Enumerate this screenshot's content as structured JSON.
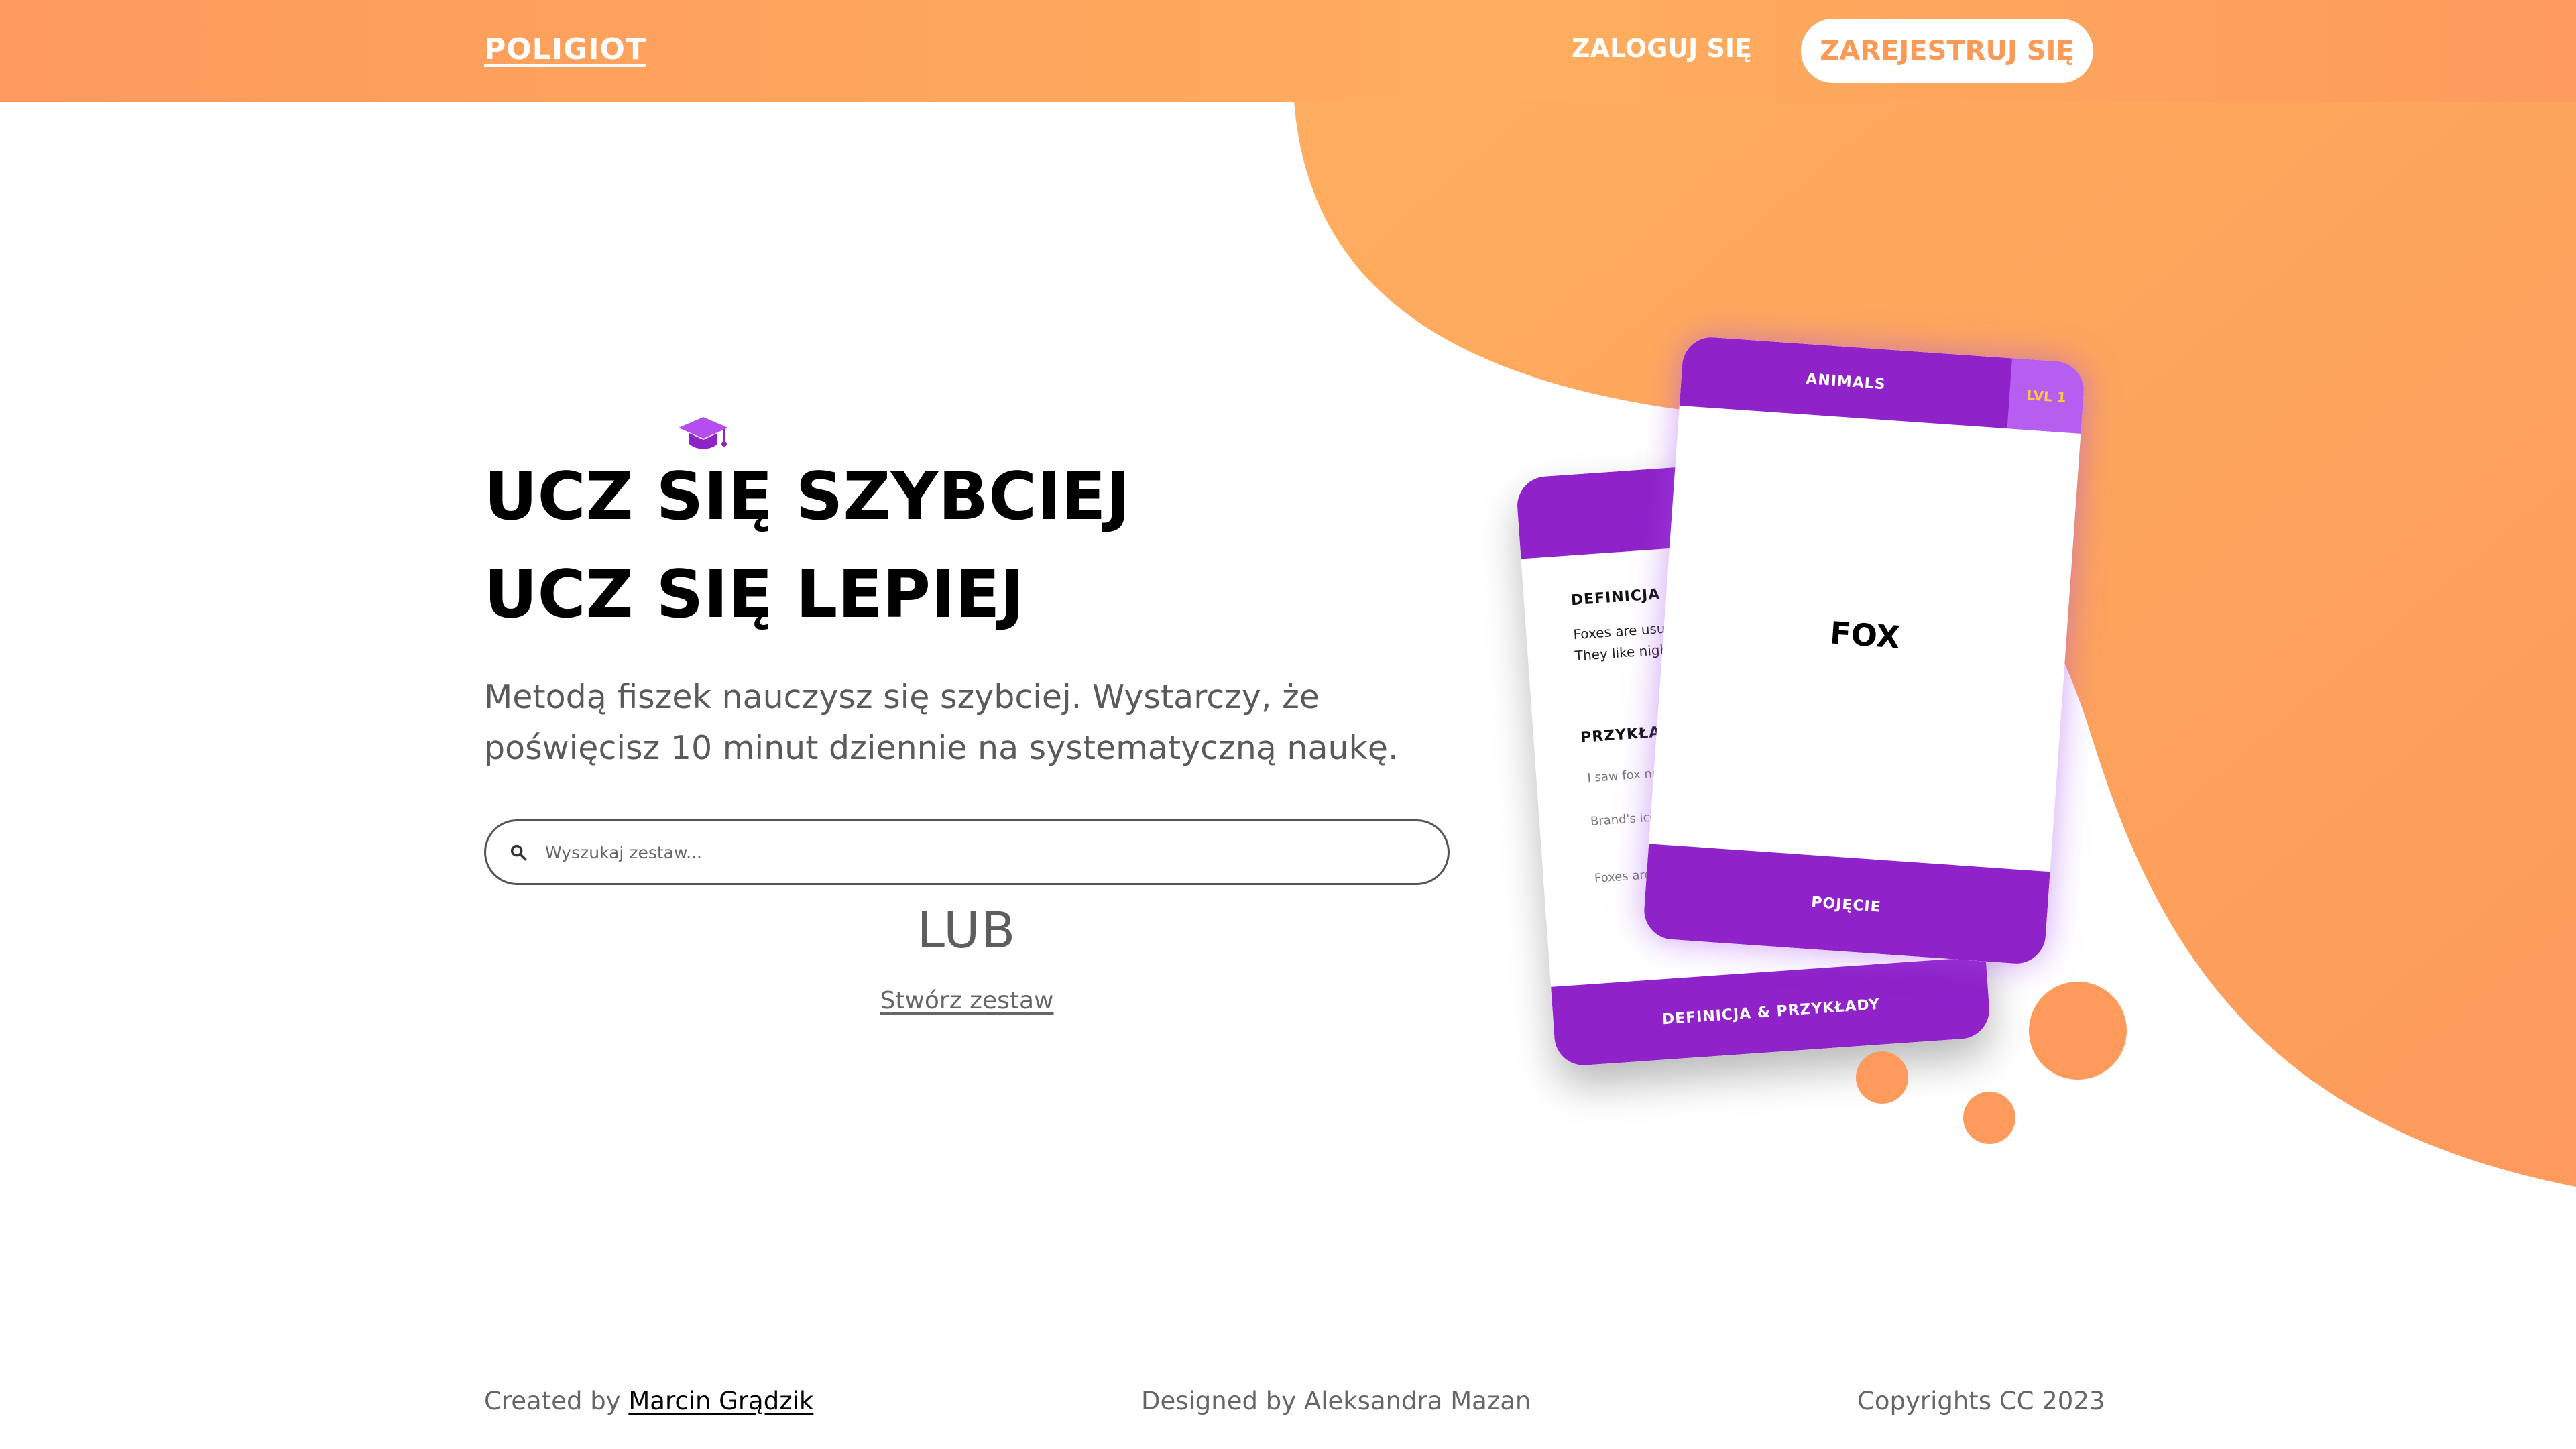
{
  "header": {
    "logo": "POLIGIOT",
    "login_label": "ZALOGUJ SIĘ",
    "register_label": "ZAREJESTRUJ SIĘ"
  },
  "hero": {
    "cap_icon": "graduation-cap-icon",
    "headline_line1": "UCZ SIĘ SZYBCIEJ",
    "headline_line2": "UCZ SIĘ LEPIEJ",
    "subtitle": "Metodą fiszek nauczysz się szybciej. Wystarczy, że poświęcisz 10 minut dziennie na systematyczną naukę.",
    "search_placeholder": "Wyszukaj zestaw...",
    "or_label": "LUB",
    "create_label": "Stwórz zestaw"
  },
  "card_back": {
    "definition_title": "DEFINICJA",
    "definition_text": "Foxes are usually in the forest. They like night life.",
    "examples_title": "PRZYKŁADY",
    "example1": "I saw fox ne",
    "example2": "Brand's ico creature a",
    "example3": "Foxes are sometim",
    "bottom_label": "DEFINICJA & PRZYKŁADY"
  },
  "card_front": {
    "category": "ANIMALS",
    "level": "LVL 1",
    "word": "FOX",
    "bottom_label": "POJĘCIE"
  },
  "footer": {
    "created_prefix": "Created by",
    "created_author": "Marcin Grądzik",
    "designed": "Designed by Aleksandra Mazan",
    "copyright": "Copyrights CC 2023"
  },
  "colors": {
    "accent_orange": "#fd9a5c",
    "accent_purple": "#8f22c9",
    "level_yellow": "#ffca3a"
  }
}
